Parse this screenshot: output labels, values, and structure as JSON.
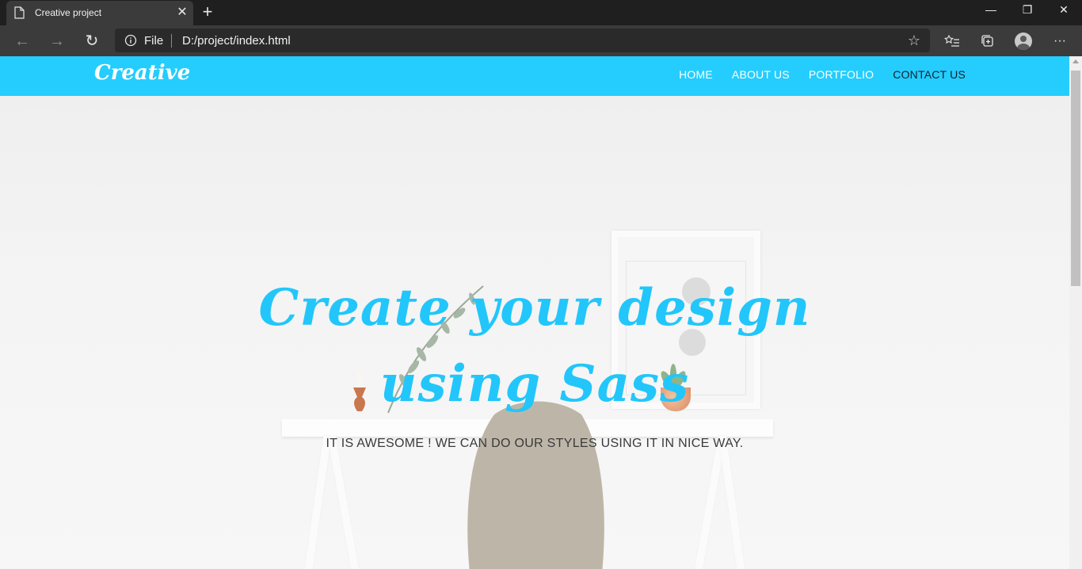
{
  "browser": {
    "tab_title": "Creative project",
    "tab_icon": "page-icon",
    "new_tab_icon": "plus-icon",
    "address": {
      "scheme_label": "File",
      "url": "D:/project/index.html"
    },
    "toolbar_icons": [
      "back-icon",
      "forward-icon",
      "refresh-icon",
      "info-icon",
      "star-icon",
      "favorites-icon",
      "collections-icon",
      "profile-icon",
      "more-icon"
    ]
  },
  "site": {
    "logo": "Creative",
    "nav": [
      {
        "label": "HOME"
      },
      {
        "label": "ABOUT US"
      },
      {
        "label": "PORTFOLIO"
      },
      {
        "label": "CONTACT US"
      }
    ],
    "hero": {
      "headline_line1": "Create your design",
      "headline_line2": "using Sass",
      "tagline": "IT IS AWESOME ! WE CAN DO OUR STYLES USING IT IN NICE WAY."
    },
    "colors": {
      "accent": "#24cdfd",
      "headline": "#22c6fa"
    }
  }
}
